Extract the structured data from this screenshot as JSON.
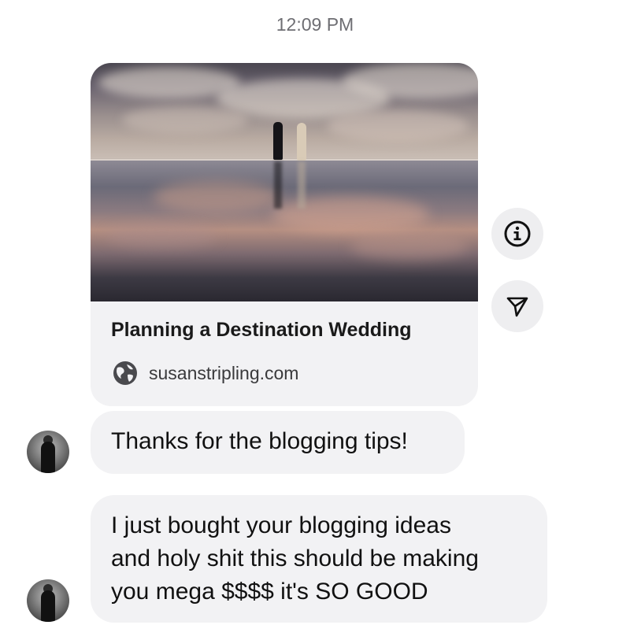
{
  "thread": {
    "timestamp": "12:09 PM"
  },
  "shared_link": {
    "title": "Planning a Destination Wedding",
    "domain": "susanstripling.com",
    "image_icon": "wedding-photo",
    "domain_icon": "globe-icon"
  },
  "actions": {
    "info_icon": "info-icon",
    "share_icon": "send-icon"
  },
  "messages": [
    {
      "text": "Thanks for the blogging tips!"
    },
    {
      "lines": [
        "I just bought your blogging ideas",
        "and holy shit this should be making",
        "you mega $$$$ it's SO GOOD"
      ]
    }
  ]
}
